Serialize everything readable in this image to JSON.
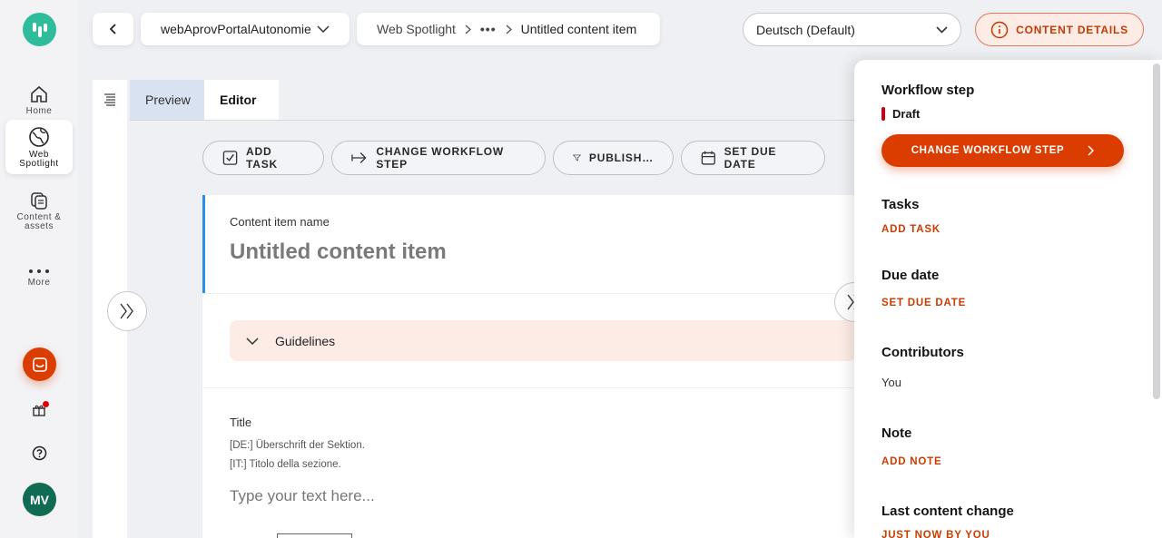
{
  "nav": {
    "items": [
      {
        "label": "Home",
        "icon": "home-icon"
      },
      {
        "label": "Web Spotlight",
        "icon": "globe-icon"
      },
      {
        "label": "Content & assets",
        "icon": "content-icon"
      },
      {
        "label": "More",
        "icon": "more-dots-icon"
      }
    ],
    "avatar_initials": "MV"
  },
  "header": {
    "project": "webAprovPortalAutonomie",
    "breadcrumb": [
      "Web Spotlight",
      "•••",
      "Untitled content item"
    ],
    "language": "Deutsch (Default)",
    "details_button": "CONTENT DETAILS"
  },
  "tabs": [
    "Preview",
    "Editor"
  ],
  "actions": [
    "ADD TASK",
    "CHANGE WORKFLOW STEP",
    "PUBLISH…",
    "SET DUE DATE"
  ],
  "editor": {
    "name_label": "Content item name",
    "name_placeholder": "Untitled content item",
    "guidelines_label": "Guidelines",
    "title_label": "Title",
    "title_guidelines": [
      "[DE:] Überschrift der Sektion.",
      "[IT:] Titolo della sezione."
    ],
    "title_placeholder": "Type your text here..."
  },
  "panel": {
    "workflow_heading": "Workflow step",
    "workflow_status": "Draft",
    "change_button": "CHANGE WORKFLOW STEP",
    "tasks_heading": "Tasks",
    "add_task": "ADD TASK",
    "due_heading": "Due date",
    "set_due": "SET DUE DATE",
    "contributors_heading": "Contributors",
    "contributor": "You",
    "note_heading": "Note",
    "add_note": "ADD NOTE",
    "last_change_heading": "Last content change",
    "last_change_value": "JUST NOW BY YOU"
  },
  "colors": {
    "accent": "#db3c00",
    "brand": "#2fbc9a",
    "status_draft": "#c90016",
    "focus": "#2b8fe3"
  }
}
